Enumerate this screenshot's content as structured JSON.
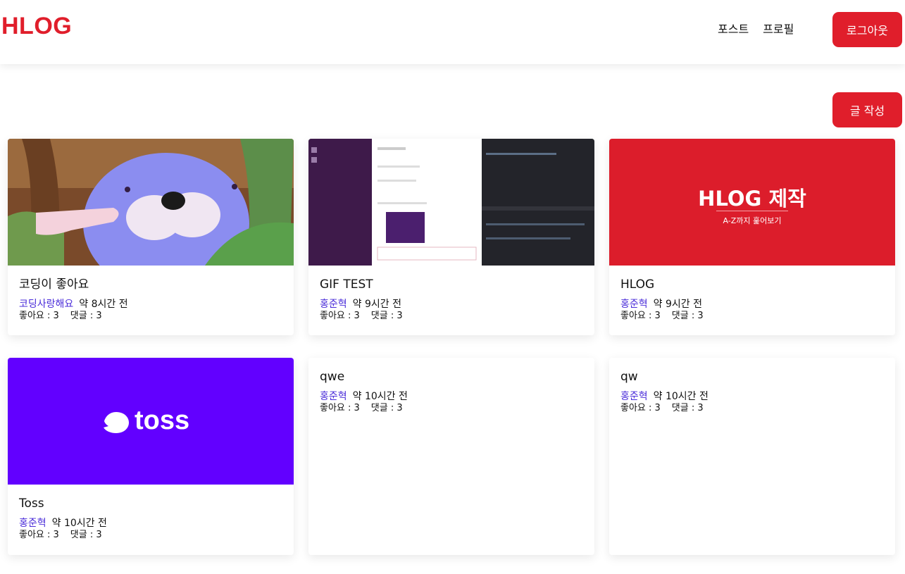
{
  "colors": {
    "brand": "#e01e2b",
    "link": "#4a2cd9",
    "toss_bg": "#6200ff"
  },
  "header": {
    "logo": "HLOG",
    "nav": [
      "포스트",
      "프로필"
    ],
    "logout_label": "로그아웃"
  },
  "toolbar": {
    "write_label": "글 작성"
  },
  "posts": [
    {
      "title": "코딩이 좋아요",
      "author": "코딩사랑해요",
      "time": "약 8시간 전",
      "likes": "좋아요 : 3",
      "comments": "댓글 : 3",
      "thumbnail": "cartoon-seal-image"
    },
    {
      "title": "GIF TEST",
      "author": "홍준혁",
      "time": "약 9시간 전",
      "likes": "좋아요 : 3",
      "comments": "댓글 : 3",
      "thumbnail": "screenshot-image"
    },
    {
      "title": "HLOG",
      "author": "홍준혁",
      "time": "약 9시간 전",
      "likes": "좋아요 : 3",
      "comments": "댓글 : 3",
      "thumbnail": "hlog-banner-image",
      "banner_title": "HLOG 제작",
      "banner_subtitle": "A-Z까지 훑어보기"
    },
    {
      "title": "Toss",
      "author": "홍준혁",
      "time": "약 10시간 전",
      "likes": "좋아요 : 3",
      "comments": "댓글 : 3",
      "thumbnail": "toss-logo-image",
      "logo_text": "toss"
    },
    {
      "title": "qwe",
      "author": "홍준혁",
      "time": "약 10시간 전",
      "likes": "좋아요 : 3",
      "comments": "댓글 : 3"
    },
    {
      "title": "qw",
      "author": "홍준혁",
      "time": "약 10시간 전",
      "likes": "좋아요 : 3",
      "comments": "댓글 : 3"
    }
  ]
}
